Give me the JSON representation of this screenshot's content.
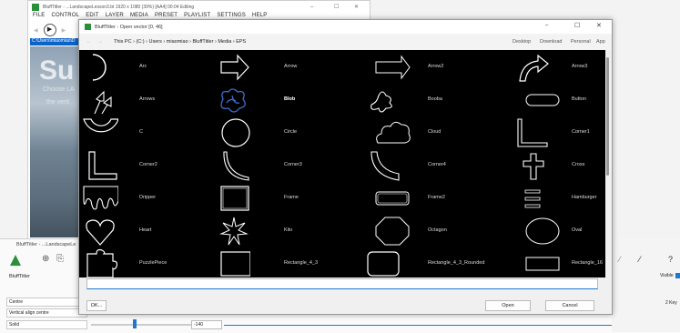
{
  "background_window": {
    "title": "BluffTitler - ...LandscapeLesson3.bt 1920 x 1080 (39%) [AA4] 00:04 Editing",
    "menu": [
      "FILE",
      "CONTROL",
      "EDIT",
      "LAYER",
      "MEDIA",
      "PRESET",
      "PLAYLIST",
      "SETTINGS",
      "HELP"
    ],
    "path_text": "C:\\Users\\miaomiao\\D",
    "scene_text": "Su",
    "scene_sub1": "Choose LA",
    "scene_sub2": "the verti"
  },
  "bottom_panel": {
    "title": "BluffTitler - ...LandscapeLe",
    "app_field": "BluffTitler",
    "field_centre": "Centre",
    "field_vertical": "Vertical align centre",
    "field_solid": "Solid",
    "number_value": "-140",
    "visible_label": "Visible",
    "keys_label": "2 Key"
  },
  "dialog": {
    "title": "BluffTitler - Open vector [0, 46]",
    "breadcrumb": [
      "This PC",
      "(C:)",
      "Users",
      "miaomiao",
      "BluffTitler",
      "Media",
      "EPS"
    ],
    "quick_links": [
      "Desktop",
      "Download",
      "Personal",
      "App"
    ],
    "ok_label": "OK...",
    "open_label": "Open",
    "cancel_label": "Cancel",
    "items": [
      [
        "Arc",
        "Arrow",
        "Arrow2",
        "Arrow3"
      ],
      [
        "Arrows",
        "Blob",
        "Booba",
        "Button"
      ],
      [
        "C",
        "Circle",
        "Cloud",
        "Corner1"
      ],
      [
        "Corner2",
        "Corner3",
        "Corner4",
        "Cross"
      ],
      [
        "Dripper",
        "Frame",
        "Frame2",
        "Hamburger"
      ],
      [
        "Heart",
        "Kilo",
        "Octagon",
        "Oval"
      ],
      [
        "PuzzlePiece",
        "Rectangle_4_3",
        "Rectangle_4_3_Rounded",
        "Rectangle_16"
      ]
    ],
    "selected_item": "Blob",
    "colors": {
      "accent": "#2277cc",
      "grid_bg": "#000000",
      "selected_icon": "#3b6fd6"
    }
  }
}
